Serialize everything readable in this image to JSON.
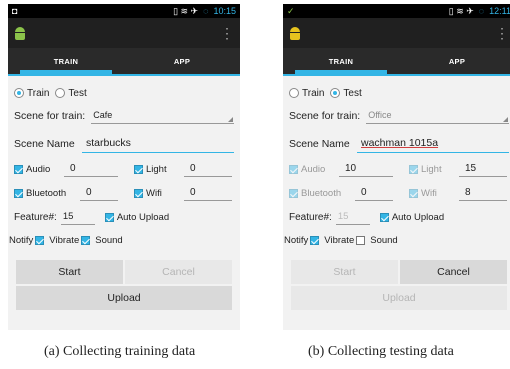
{
  "colors": {
    "accent": "#33b5e5",
    "android_green": "#8bc34a",
    "android_yellow": "#e6c31e"
  },
  "screens": [
    {
      "status": {
        "left_icon": "◘",
        "right_icons": "▯ ≋ ✈",
        "sync": "◌",
        "time": "10:15"
      },
      "app_icon": "android-robot-icon",
      "tabs": [
        "TRAIN",
        "APP"
      ],
      "mode": {
        "train": "Train",
        "test": "Test",
        "selected": "train"
      },
      "scene": {
        "label": "Scene for train:",
        "value": "Cafe"
      },
      "scene_name": {
        "label": "Scene Name",
        "value": "starbucks"
      },
      "sensors": [
        {
          "label": "Audio",
          "value": "0",
          "checked": true
        },
        {
          "label": "Light",
          "value": "0",
          "checked": true
        },
        {
          "label": "Bluetooth",
          "value": "0",
          "checked": true
        },
        {
          "label": "Wifi",
          "value": "0",
          "checked": true
        }
      ],
      "feature": {
        "label": "Feature#:",
        "value": "15",
        "auto_upload": "Auto Upload"
      },
      "notify": {
        "label": "Notify",
        "vibrate": "Vibrate",
        "sound": "Sound",
        "vibrate_on": true,
        "sound_on": true
      },
      "buttons": {
        "start": "Start",
        "cancel": "Cancel",
        "upload": "Upload"
      }
    },
    {
      "status": {
        "left_icon": "✓",
        "right_icons": "▯ ≋ ✈",
        "sync": "◌",
        "time": "12:11"
      },
      "app_icon": "android-robot-icon",
      "tabs": [
        "TRAIN",
        "APP"
      ],
      "mode": {
        "train": "Train",
        "test": "Test",
        "selected": "test"
      },
      "scene": {
        "label": "Scene for train:",
        "value": "Office"
      },
      "scene_name": {
        "label": "Scene Name",
        "value": "wachman 1015a"
      },
      "sensors": [
        {
          "label": "Audio",
          "value": "10",
          "checked": true
        },
        {
          "label": "Light",
          "value": "15",
          "checked": true
        },
        {
          "label": "Bluetooth",
          "value": "0",
          "checked": true
        },
        {
          "label": "Wifi",
          "value": "8",
          "checked": true
        }
      ],
      "feature": {
        "label": "Feature#:",
        "value": "15",
        "auto_upload": "Auto Upload"
      },
      "notify": {
        "label": "Notify",
        "vibrate": "Vibrate",
        "sound": "Sound",
        "vibrate_on": true,
        "sound_on": false
      },
      "buttons": {
        "start": "Start",
        "cancel": "Cancel",
        "upload": "Upload"
      }
    }
  ],
  "captions": [
    "(a) Collecting training data",
    "(b) Collecting testing data"
  ]
}
